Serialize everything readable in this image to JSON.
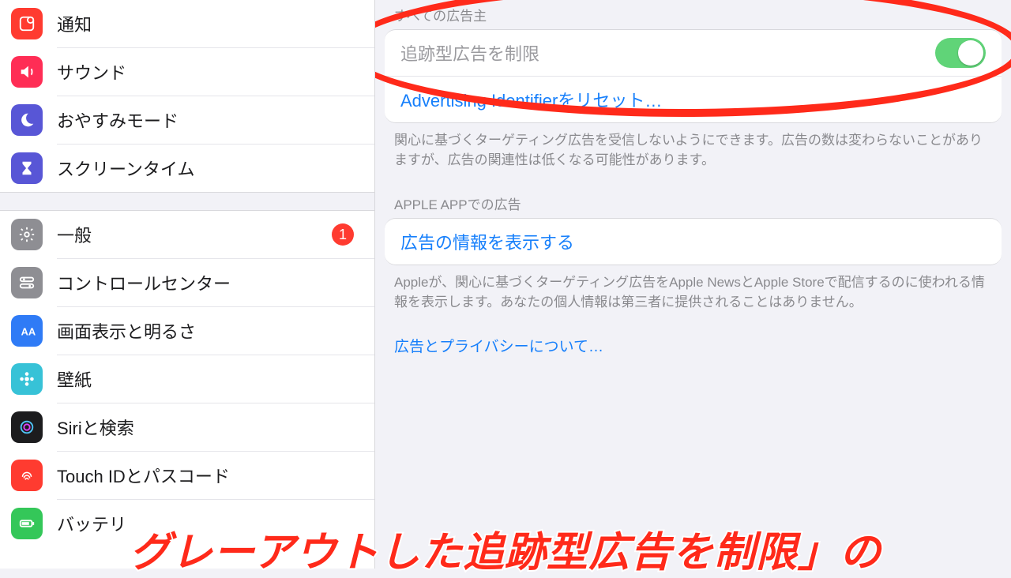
{
  "sidebar": {
    "group1": [
      {
        "label": "通知",
        "icon": "notification",
        "bg": "#ff3b30"
      },
      {
        "label": "サウンド",
        "icon": "sound",
        "bg": "#ff2d55"
      },
      {
        "label": "おやすみモード",
        "icon": "dnd",
        "bg": "#5856d6"
      },
      {
        "label": "スクリーンタイム",
        "icon": "screentime",
        "bg": "#5856d6"
      }
    ],
    "group2": [
      {
        "label": "一般",
        "icon": "general",
        "bg": "#8e8e93",
        "badge": "1"
      },
      {
        "label": "コントロールセンター",
        "icon": "control",
        "bg": "#8e8e93"
      },
      {
        "label": "画面表示と明るさ",
        "icon": "display",
        "bg": "#2f7bf6"
      },
      {
        "label": "壁紙",
        "icon": "wallpaper",
        "bg": "#37c2d7"
      },
      {
        "label": "Siriと検索",
        "icon": "siri",
        "bg": "#1c1c1e"
      },
      {
        "label": "Touch IDとパスコード",
        "icon": "touchid",
        "bg": "#ff3b30"
      },
      {
        "label": "バッテリ",
        "icon": "battery",
        "bg": "#34c759"
      }
    ]
  },
  "detail": {
    "section1": {
      "header": "すべての広告主",
      "limit_label": "追跡型広告を制限",
      "limit_on": true,
      "reset_label": "Advertising Identifierをリセット…",
      "footer": "関心に基づくターゲティング広告を受信しないようにできます。広告の数は変わらないことがありますが、広告の関連性は低くなる可能性があります。"
    },
    "section2": {
      "header": "APPLE APPでの広告",
      "show_label": "広告の情報を表示する",
      "footer": "Appleが、関心に基づくターゲティング広告をApple NewsとApple Storeで配信するのに使われる情報を表示します。あなたの個人情報は第三者に提供されることはありません。"
    },
    "privacy_link": "広告とプライバシーについて…"
  },
  "caption": "グレーアウトした追跡型広告を制限」の"
}
